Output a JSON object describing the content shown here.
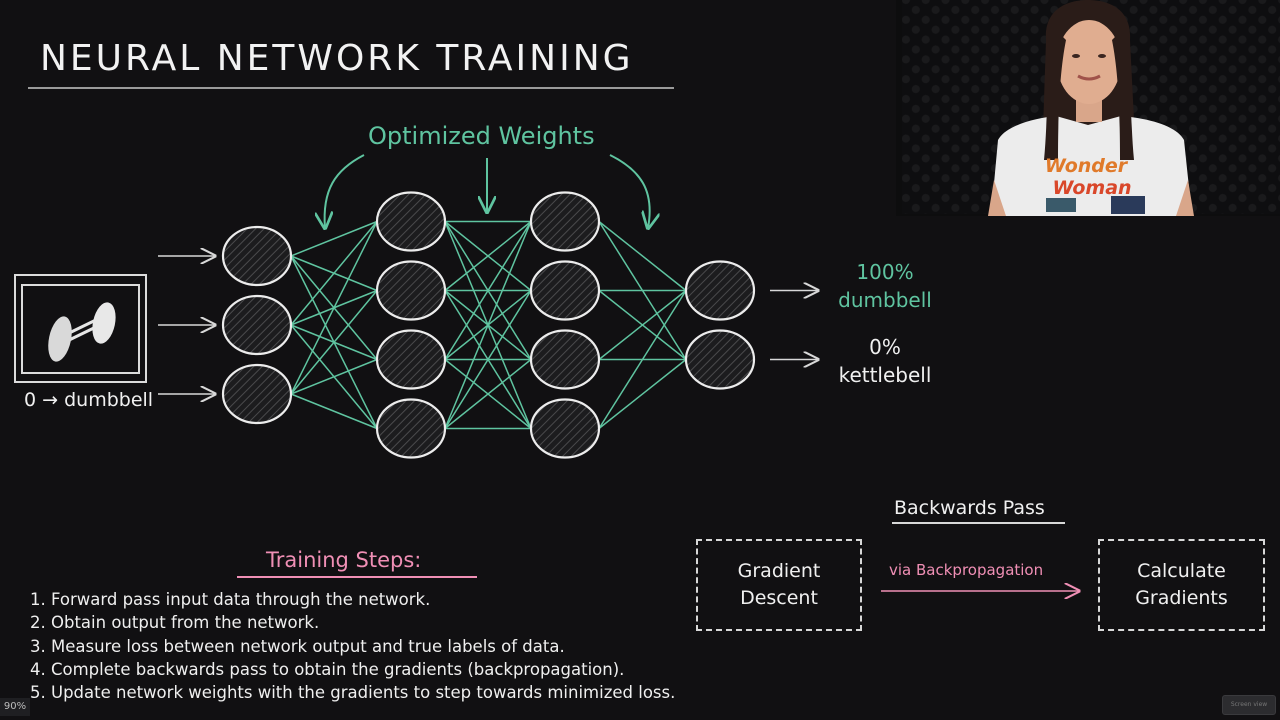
{
  "slide": {
    "title": "NEURAL NETWORK TRAINING",
    "optimized_weights_label": "Optimized Weights",
    "input_caption": "0 → dumbbell",
    "input_image": "dumbbell-drawing",
    "network": {
      "layers": [
        3,
        4,
        4,
        2
      ],
      "layer_names": [
        "input",
        "hidden-1",
        "hidden-2",
        "output"
      ]
    },
    "outputs": [
      {
        "percent": "100%",
        "label": "dumbbell",
        "color": "#5fc4a0"
      },
      {
        "percent": "0%",
        "label": "kettlebell",
        "color": "#f0f0f0"
      }
    ],
    "training_steps": {
      "title": "Training Steps:",
      "items": [
        "1. Forward pass input data through the network.",
        "2. Obtain output from the network.",
        "3. Measure loss between network output and true labels of data.",
        "4. Complete backwards pass to obtain the gradients (backpropagation).",
        "5. Update network weights with the gradients to step towards minimized loss."
      ]
    },
    "backwards_pass": {
      "title": "Backwards Pass",
      "left_box": "Gradient\nDescent",
      "left_box_lines": [
        "Gradient",
        "Descent"
      ],
      "right_box_lines": [
        "Calculate",
        "Gradients"
      ],
      "arrow_label": "via Backpropagation"
    }
  },
  "presenter": {
    "shirt_text_line1": "Wonder",
    "shirt_text_line2": "Woman"
  },
  "ui": {
    "zoom_level": "90%",
    "corner_button": "Screen view"
  },
  "colors": {
    "background": "#111012",
    "accent_green": "#5fc4a0",
    "accent_pink": "#f08fb5",
    "chalk_white": "#f0f0f0"
  }
}
